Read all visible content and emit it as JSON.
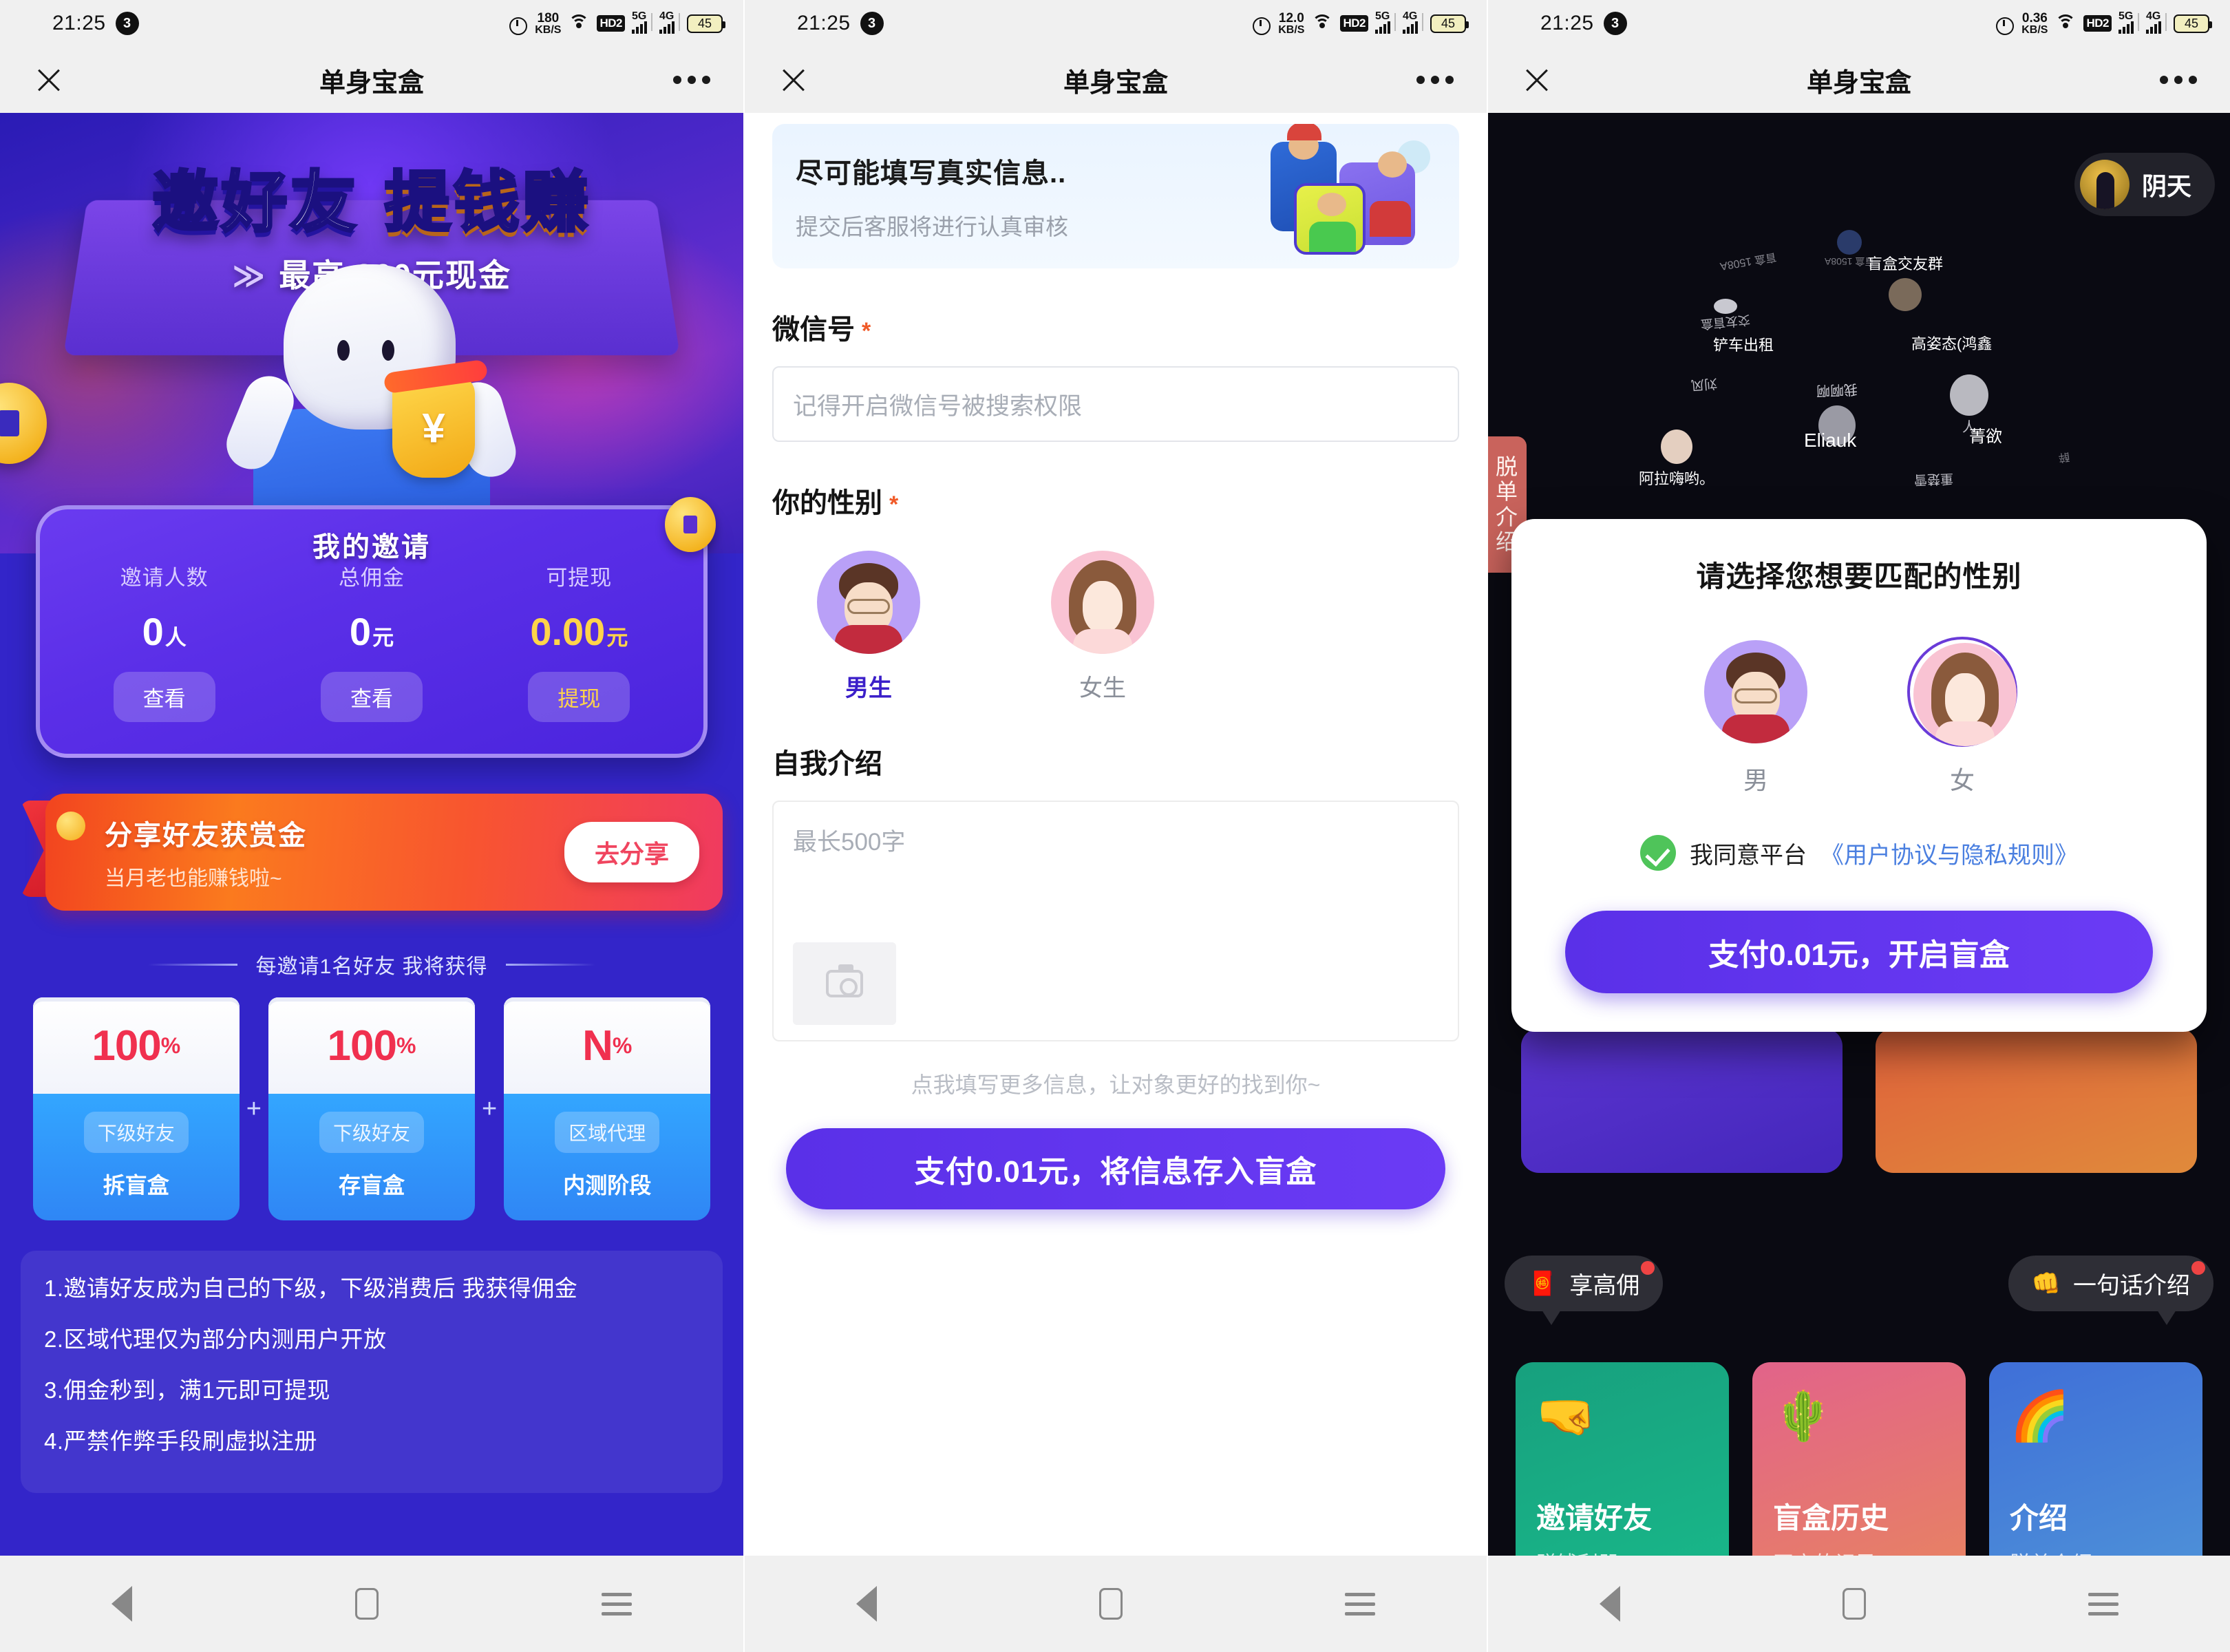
{
  "app": {
    "title": "单身宝盒"
  },
  "screens": [
    {
      "status": {
        "time": "21:25",
        "badge": "3",
        "speed": "180",
        "speed_unit": "KB/S",
        "hd": "HD2",
        "net1": "5G",
        "net2": "4G",
        "battery": "45"
      }
    },
    {
      "status": {
        "time": "21:25",
        "badge": "3",
        "speed": "12.0",
        "speed_unit": "KB/S",
        "hd": "HD2",
        "net1": "5G",
        "net2": "4G",
        "battery": "45"
      }
    },
    {
      "status": {
        "time": "21:25",
        "badge": "3",
        "speed": "0.36",
        "speed_unit": "KB/S",
        "hd": "HD2",
        "net1": "5G",
        "net2": "4G",
        "battery": "45"
      }
    }
  ],
  "invite": {
    "hero_title_1": "邀好友",
    "hero_title_2": "提钱赚",
    "hero_sub_chev": "≫",
    "hero_sub": "最高        800元现金",
    "my_invite_label": "我的邀请",
    "stats": [
      {
        "label": "邀请人数",
        "value": "0",
        "unit": "人",
        "button": "查看",
        "highlight": false
      },
      {
        "label": "总佣金",
        "value": "0",
        "unit": "元",
        "button": "查看",
        "highlight": false
      },
      {
        "label": "可提现",
        "value": "0.00",
        "unit": "元",
        "button": "提现",
        "highlight": true
      }
    ],
    "share": {
      "title": "分享好友获赏金",
      "subtitle": "当月老也能赚钱啦~",
      "button": "去分享"
    },
    "divider_text": "每邀请1名好友 我将获得",
    "percent_cards": [
      {
        "pct": "100",
        "sym": "%",
        "tag": "下级好友",
        "name": "拆盲盒"
      },
      {
        "pct": "100",
        "sym": "%",
        "tag": "下级好友",
        "name": "存盲盒"
      },
      {
        "pct": "N",
        "sym": "%",
        "tag": "区域代理",
        "name": "内测阶段"
      }
    ],
    "plus_sign": "+",
    "rules": [
      "1.邀请好友成为自己的下级，下级消费后 我获得佣金",
      "2.区域代理仅为部分内测用户开放",
      "3.佣金秒到，满1元即可提现",
      "4.严禁作弊手段刷虚拟注册"
    ]
  },
  "form": {
    "notice_title": "尽可能填写真实信息..",
    "notice_sub": "提交后客服将进行认真审核",
    "wechat_label": "微信号",
    "required_mark": "*",
    "wechat_placeholder": "记得开启微信号被搜索权限",
    "gender_label": "你的性别",
    "gender_options": [
      {
        "label": "男生",
        "selected": true
      },
      {
        "label": "女生",
        "selected": false
      }
    ],
    "intro_label": "自我介绍",
    "intro_placeholder": "最长500字",
    "more_hint": "点我填写更多信息，让对象更好的找到你~",
    "submit_button": "支付0.01元，将信息存入盲盒"
  },
  "discover": {
    "weather_text": "阴天",
    "side_tab": "脱单介绍",
    "sphere_nodes": [
      {
        "name": "盲盒交友群"
      },
      {
        "name": "盲盒 1508A"
      },
      {
        "name": "交友盲盒"
      },
      {
        "name": "铲车出租"
      },
      {
        "name": "高姿态(鸿鑫"
      },
      {
        "name": "我啊啊"
      },
      {
        "name": "Eliauk"
      },
      {
        "name": "菁欲"
      },
      {
        "name": "阿拉嗨哟。"
      },
      {
        "name": "重楚雪"
      },
      {
        "name": "刘风"
      },
      {
        "name": "人"
      },
      {
        "name": "醉"
      }
    ],
    "modal": {
      "title": "请选择您想要匹配的性别",
      "options": [
        {
          "label": "男",
          "selected": false
        },
        {
          "label": "女",
          "selected": true
        }
      ],
      "agree_text": "我同意平台",
      "agree_link": "《用户协议与隐私规则》",
      "button": "支付0.01元，开启盲盒"
    },
    "bubbles": [
      {
        "emoji": "🧧",
        "text": "享高佣"
      },
      {
        "emoji": "👊",
        "text": "一句话介绍"
      }
    ],
    "tiles": [
      {
        "icon": "🤜",
        "title": "邀请好友",
        "sub": "赚钱利器"
      },
      {
        "icon": "🌵",
        "title": "盲盒历史",
        "sub": "开启的记录"
      },
      {
        "icon": "🌈",
        "title": "介绍",
        "sub": "脱单介绍"
      }
    ]
  },
  "nav": {
    "back": "back-icon",
    "home": "home-icon",
    "menu": "menu-icon"
  }
}
